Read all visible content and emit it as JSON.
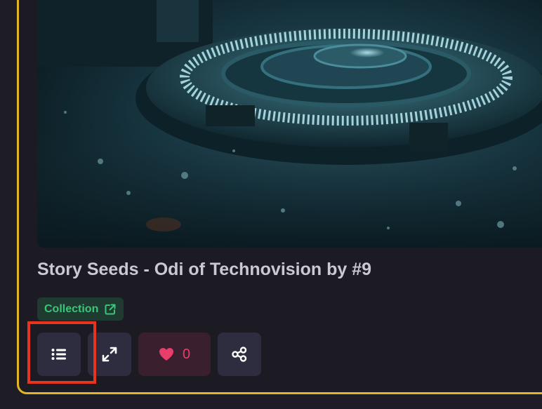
{
  "card": {
    "title": "Story Seeds - Odi of Technovision by #9",
    "image_alt": "sci-fi manhole cover on wet dark street",
    "collection_label": "Collection",
    "border_color": "#e3b523"
  },
  "actions": {
    "list_icon": "list-icon",
    "expand_icon": "expand-icon",
    "like_icon": "heart-icon",
    "like_count": "0",
    "share_icon": "share-icon"
  },
  "colors": {
    "background": "#1d1c27",
    "collection_text": "#39c777",
    "like_accent": "#e83e6c",
    "highlight": "#e8331f"
  }
}
